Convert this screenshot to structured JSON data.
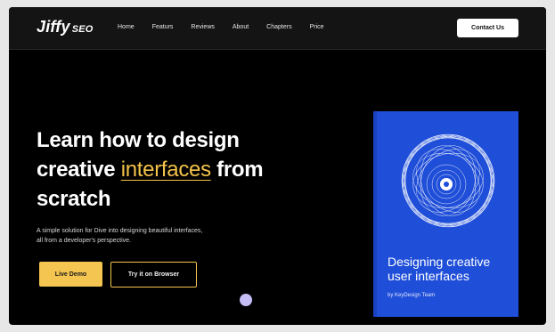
{
  "brand": {
    "name": "Jiffy",
    "suffix": "SEO"
  },
  "nav": {
    "items": [
      "Home",
      "Featurs",
      "Reviews",
      "About",
      "Chapters",
      "Price"
    ],
    "cta": "Contact Us"
  },
  "hero": {
    "title_line1": "Learn how to design",
    "title_line2a": "creative ",
    "title_highlight": "interfaces",
    "title_line2b": " from",
    "title_line3": "scratch",
    "subtitle_line1": "A simple solution for Dive into designing beautiful interfaces,",
    "subtitle_line2": "all from a developer's perspective.",
    "primary_button": "Live Demo",
    "secondary_button": "Try it on Browser"
  },
  "book": {
    "title_line1": "Designing creative",
    "title_line2": "user interfaces",
    "author": "by KeyDesign Team"
  },
  "colors": {
    "accent": "#f4c550",
    "book_blue": "#1f4ed8",
    "background": "#000000",
    "dot": "#c5bdf6"
  }
}
